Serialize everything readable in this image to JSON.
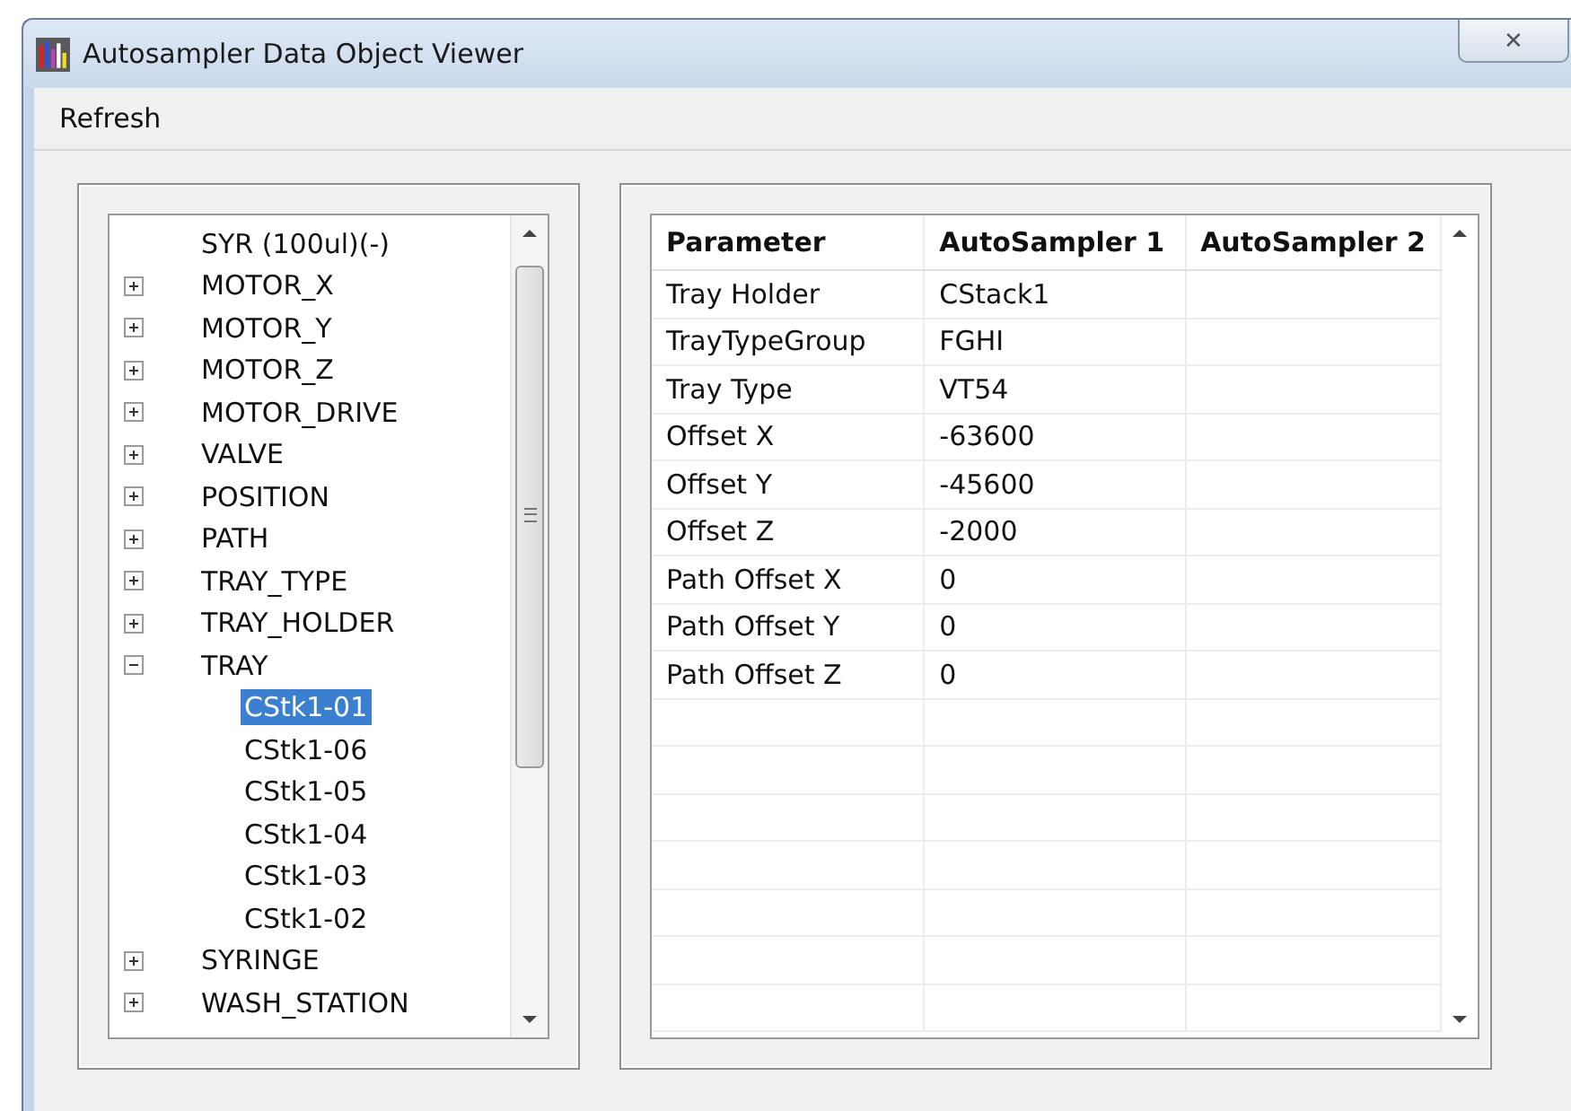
{
  "window": {
    "title": "Autosampler Data Object Viewer",
    "close": "✕"
  },
  "menu": [
    {
      "label": "Refresh"
    }
  ],
  "tree": {
    "items": [
      {
        "label": "SYR (100ul)(-)",
        "selected": false
      },
      {
        "label": "MOTOR_X",
        "expanded": false,
        "selected": false
      },
      {
        "label": "MOTOR_Y",
        "expanded": false,
        "selected": false
      },
      {
        "label": "MOTOR_Z",
        "expanded": false,
        "selected": false
      },
      {
        "label": "MOTOR_DRIVE",
        "expanded": false,
        "selected": false
      },
      {
        "label": "VALVE",
        "expanded": false,
        "selected": false
      },
      {
        "label": "POSITION",
        "expanded": false,
        "selected": false
      },
      {
        "label": "PATH",
        "expanded": false,
        "selected": false
      },
      {
        "label": "TRAY_TYPE",
        "expanded": false,
        "selected": false
      },
      {
        "label": "TRAY_HOLDER",
        "expanded": false,
        "selected": false
      },
      {
        "label": "TRAY",
        "expanded": true,
        "selected": false,
        "children": [
          {
            "label": "CStk1-01",
            "selected": true
          },
          {
            "label": "CStk1-06",
            "selected": false
          },
          {
            "label": "CStk1-05",
            "selected": false
          },
          {
            "label": "CStk1-04",
            "selected": false
          },
          {
            "label": "CStk1-03",
            "selected": false
          },
          {
            "label": "CStk1-02",
            "selected": false
          }
        ]
      },
      {
        "label": "SYRINGE",
        "expanded": false,
        "selected": false
      },
      {
        "label": "WASH_STATION",
        "expanded": false,
        "selected": false
      }
    ]
  },
  "table": {
    "columns": [
      "Parameter",
      "AutoSampler 1",
      "AutoSampler 2"
    ],
    "rows": [
      [
        "Tray Holder",
        "CStack1"
      ],
      [
        "TrayTypeGroup",
        "FGHI"
      ],
      [
        "Tray Type",
        "VT54"
      ],
      [
        "Offset X",
        "-63600"
      ],
      [
        "Offset Y",
        "-45600"
      ],
      [
        "Offset Z",
        "-2000"
      ],
      [
        "Path Offset X",
        "0"
      ],
      [
        "Path Offset Y",
        "0"
      ],
      [
        "Path Offset Z",
        "0"
      ]
    ]
  }
}
